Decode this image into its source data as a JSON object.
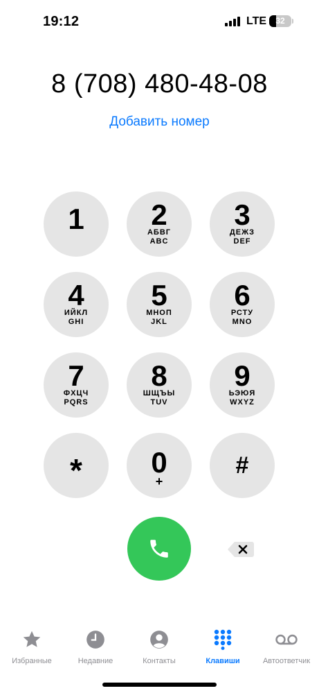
{
  "status_bar": {
    "time": "19:12",
    "network": "LTE",
    "battery_percent": "32",
    "battery_level": 0.32
  },
  "dialer": {
    "number": "8 (708) 480-48-08",
    "add_number_label": "Добавить номер",
    "accent_color": "#0a7aff",
    "call_color": "#34c759"
  },
  "keypad": {
    "keys": [
      {
        "digit": "1",
        "ru": "",
        "en": ""
      },
      {
        "digit": "2",
        "ru": "АБВГ",
        "en": "ABC"
      },
      {
        "digit": "3",
        "ru": "ДЕЖЗ",
        "en": "DEF"
      },
      {
        "digit": "4",
        "ru": "ИЙКЛ",
        "en": "GHI"
      },
      {
        "digit": "5",
        "ru": "МНОП",
        "en": "JKL"
      },
      {
        "digit": "6",
        "ru": "РСТУ",
        "en": "MNO"
      },
      {
        "digit": "7",
        "ru": "ФХЦЧ",
        "en": "PQRS"
      },
      {
        "digit": "8",
        "ru": "ШЩЪЫ",
        "en": "TUV"
      },
      {
        "digit": "9",
        "ru": "ЬЭЮЯ",
        "en": "WXYZ"
      }
    ],
    "star": "*",
    "zero": {
      "digit": "0",
      "sub": "+"
    },
    "hash": "#"
  },
  "icons": {
    "call": "phone-icon",
    "delete": "backspace-icon",
    "favorites": "star-icon",
    "recents": "clock-icon",
    "contacts": "person-circle-icon",
    "keypad": "keypad-grid-icon",
    "voicemail": "voicemail-icon"
  },
  "tab_bar": {
    "tabs": [
      {
        "label": "Избранные",
        "active": false
      },
      {
        "label": "Недавние",
        "active": false
      },
      {
        "label": "Контакты",
        "active": false
      },
      {
        "label": "Клавиши",
        "active": true
      },
      {
        "label": "Автоответчик",
        "active": false
      }
    ]
  }
}
